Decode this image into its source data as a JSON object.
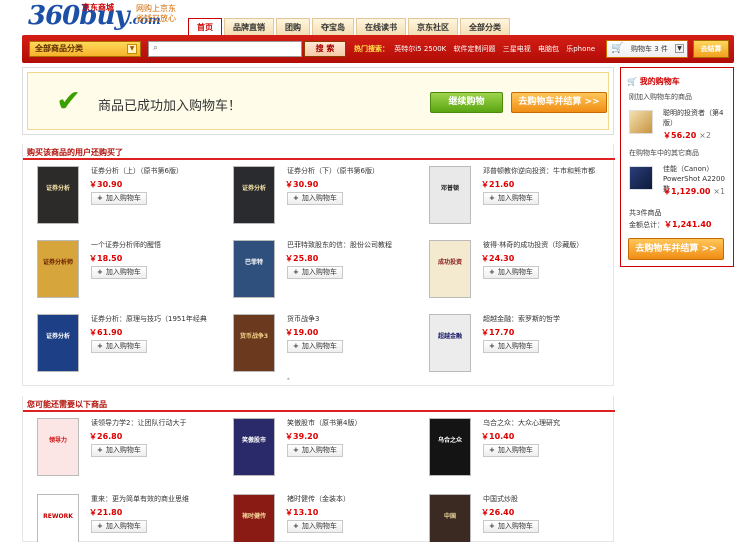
{
  "header": {
    "logo_main": "360buy",
    "logo_com": ".com",
    "logo_cn": "京东商城",
    "slogan_line1": "网购上京东",
    "slogan_line2": "省钱又放心",
    "nav": [
      "首页",
      "品牌直销",
      "团购",
      "夺宝岛",
      "在线读书",
      "京东社区",
      "全部分类"
    ],
    "category_label": "全部商品分类",
    "search_placeholder": "",
    "search_button": "搜 索",
    "hot_label": "热门搜索：",
    "hot_terms": [
      "英特尔i5 2500K",
      "软件定制问题",
      "三星电视",
      "电脑包",
      "乐phone"
    ],
    "cart_label": "购物车 3 件",
    "checkout_label": "去结算"
  },
  "success": {
    "message": "商品已成功加入购物车！",
    "continue_label": "继续购物",
    "pay_label": "去购物车并结算 >>"
  },
  "section1": {
    "title": "购买该商品的用户还购买了",
    "items": [
      {
        "name": "证券分析（上）（原书第6版）",
        "price": "￥30.90",
        "add": "加入购物车",
        "cover_text": "证券分析",
        "cover_bg": "#2d2a2a",
        "cover_fg": "#f5e3a8"
      },
      {
        "name": "证券分析（下）（原书第6版）",
        "price": "￥30.90",
        "add": "加入购物车",
        "cover_text": "证券分析",
        "cover_bg": "#2a2b2f",
        "cover_fg": "#f5e3a8"
      },
      {
        "name": "邓普顿教你逆向投资：牛市和熊市都",
        "price": "￥21.60",
        "add": "加入购物车",
        "cover_text": "邓普顿",
        "cover_bg": "#e9e9e9",
        "cover_fg": "#222222"
      },
      {
        "name": "一个证券分析师的醒悟",
        "price": "￥18.50",
        "add": "加入购物车",
        "cover_text": "证券分析师",
        "cover_bg": "#d6a53b",
        "cover_fg": "#6a1f00"
      },
      {
        "name": "巴菲特致股东的信：股份公司教程",
        "price": "￥25.80",
        "add": "加入购物车",
        "cover_text": "巴菲特",
        "cover_bg": "#2f4f7c",
        "cover_fg": "#ffffff"
      },
      {
        "name": "彼得·林奇的成功投资（珍藏版）",
        "price": "￥24.30",
        "add": "加入购物车",
        "cover_text": "成功投资",
        "cover_bg": "#f3ead0",
        "cover_fg": "#8a1a1a"
      },
      {
        "name": "证券分析：原理与技巧（1951年经典",
        "price": "￥61.90",
        "add": "加入购物车",
        "cover_text": "证券分析",
        "cover_bg": "#1c3f85",
        "cover_fg": "#ffffff"
      },
      {
        "name": "货币战争3",
        "price": "￥19.00",
        "add": "加入购物车",
        "cover_text": "货币战争3",
        "cover_bg": "#6b3a1e",
        "cover_fg": "#f3d28a"
      },
      {
        "name": "超越金融：索罗斯的哲学",
        "price": "￥17.70",
        "add": "加入购物车",
        "cover_text": "超越金融",
        "cover_bg": "#ececec",
        "cover_fg": "#1d1d6b"
      }
    ]
  },
  "section2": {
    "title": "您可能还需要以下商品",
    "items": [
      {
        "name": "读领导力学2：让团队行动大于",
        "price": "￥26.80",
        "add": "加入购物车",
        "cover_text": "领导力",
        "cover_bg": "#fbe5e5",
        "cover_fg": "#cc1111"
      },
      {
        "name": "笑傲股市（原书第4版）",
        "price": "￥39.20",
        "add": "加入购物车",
        "cover_text": "笑傲股市",
        "cover_bg": "#2a2a6a",
        "cover_fg": "#ffffff"
      },
      {
        "name": "乌合之众：大众心理研究",
        "price": "￥10.40",
        "add": "加入购物车",
        "cover_text": "乌合之众",
        "cover_bg": "#141414",
        "cover_fg": "#ffffff"
      },
      {
        "name": "重来：更为简单有效的商业思维",
        "price": "￥21.80",
        "add": "加入购物车",
        "cover_text": "REWORK",
        "cover_bg": "#ffffff",
        "cover_fg": "#c00000"
      },
      {
        "name": "褚时健传（金装本）",
        "price": "￥13.10",
        "add": "加入购物车",
        "cover_text": "褚时健传",
        "cover_bg": "#8a1a14",
        "cover_fg": "#f4d59a"
      },
      {
        "name": "中国式炒股",
        "price": "￥26.40",
        "add": "加入购物车",
        "cover_text": "中国",
        "cover_bg": "#3a2a22",
        "cover_fg": "#f0d9a0"
      }
    ]
  },
  "cart": {
    "title": "我的购物车",
    "added_label": "刚加入购物车的商品",
    "added_item": {
      "name": "聪明的投资者（第4版）",
      "price": "￥56.20",
      "qty": "×2"
    },
    "other_label": "在购物车中的其它商品",
    "other_item": {
      "name": "佳能（Canon）PowerShot A2200 数",
      "price": "￥1,129.00",
      "qty": "×1"
    },
    "total_count": "共3件商品",
    "total_amount_label": "金额总计：",
    "total_amount": "￥1,241.40",
    "pay_label": "去购物车并结算 >>"
  },
  "colors": {
    "accent": "#c00000",
    "green": "#3aa000",
    "price": "#dd0000"
  }
}
